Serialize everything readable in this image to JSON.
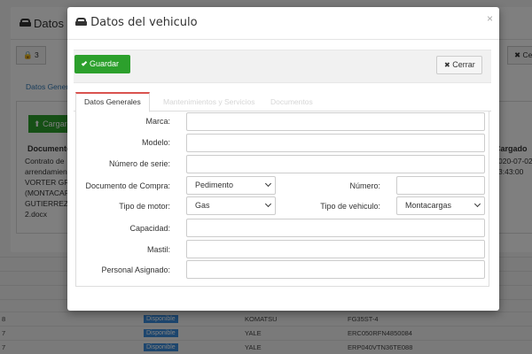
{
  "background": {
    "rows": [
      {
        "num": "8",
        "status": "Disponible",
        "brand": "KOMATSU",
        "model": "FG35ST-4"
      },
      {
        "num": "7",
        "status": "Disponible",
        "brand": "YALE",
        "model": "ERC050RFN4850084"
      },
      {
        "num": "7",
        "status": "Disponible",
        "brand": "YALE",
        "model": "ERP040VTN36TE088"
      }
    ]
  },
  "back_modal": {
    "title": "Datos del",
    "lock_label": "3",
    "close_label": "Cer",
    "tab_label": "Datos Genera",
    "upload_label": "Cargar",
    "col_document": "Documento",
    "col_loaded": "Cargado",
    "doc_lines": [
      "Contrato de",
      "arrendamien",
      "VORTER GRO",
      "(MONTACARG",
      "GUTIERREZ)",
      "2.docx"
    ],
    "date_lines": [
      "020-07-02",
      "3:43:00"
    ],
    "left_fragment": "o"
  },
  "modal": {
    "title": "Datos del vehiculo",
    "close_x": "×",
    "save_label": "Guardar",
    "close_label": "Cerrar",
    "tabs": [
      "Datos Generales",
      "Mantenimientos y Servicios",
      "Documentos"
    ],
    "fields": {
      "marca": {
        "label": "Marca:",
        "value": ""
      },
      "modelo": {
        "label": "Modelo:",
        "value": ""
      },
      "serie": {
        "label": "Número de serie:",
        "value": ""
      },
      "documento": {
        "label": "Documento de Compra:",
        "value": "Pedimento"
      },
      "numero": {
        "label": "Número:",
        "value": ""
      },
      "motor": {
        "label": "Tipo de motor:",
        "value": "Gas"
      },
      "vehiculo": {
        "label": "Tipo de vehiculo:",
        "value": "Montacargas"
      },
      "capacidad": {
        "label": "Capacidad:",
        "value": ""
      },
      "mastil": {
        "label": "Mastil:",
        "value": ""
      },
      "personal": {
        "label": "Personal Asignado:",
        "value": ""
      }
    }
  }
}
